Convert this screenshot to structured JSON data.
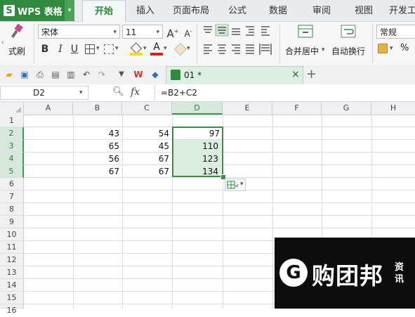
{
  "app": {
    "logo": "S",
    "name": "WPS 表格",
    "dropdown_glyph": "▾"
  },
  "tabs": [
    {
      "label": "开始",
      "active": true
    },
    {
      "label": "插入"
    },
    {
      "label": "页面布局"
    },
    {
      "label": "公式"
    },
    {
      "label": "数据"
    },
    {
      "label": "审阅"
    },
    {
      "label": "视图"
    },
    {
      "label": "开发工"
    }
  ],
  "ribbon": {
    "format_painter_label": "式刷",
    "font_name": "宋体",
    "font_size": "11",
    "grow_font": "A",
    "shrink_font": "A",
    "bold": "B",
    "italic": "I",
    "underline": "U",
    "font_color_letter": "A",
    "merge_label": "合并居中",
    "wrap_label": "自动换行",
    "number_format": "常规",
    "percent": "%"
  },
  "quickbar": {
    "doc_tab_label": "01 *",
    "close_glyph": "×",
    "new_tab_glyph": "+"
  },
  "formula_bar": {
    "name_box": "D2",
    "fx": "fx",
    "formula": "=B2+C2"
  },
  "grid": {
    "columns": [
      "A",
      "B",
      "C",
      "D",
      "E",
      "F",
      "G",
      "H"
    ],
    "active_column": "D",
    "rows": [
      "1",
      "2",
      "3",
      "4",
      "5",
      "6",
      "7",
      "8",
      "9",
      "10",
      "11",
      "12",
      "13",
      "14",
      "15",
      "16"
    ],
    "active_rows": [
      "2",
      "3",
      "4",
      "5"
    ],
    "cells": [
      {
        "ref": "B2",
        "value": "43"
      },
      {
        "ref": "C2",
        "value": "54"
      },
      {
        "ref": "D2",
        "value": "97"
      },
      {
        "ref": "B3",
        "value": "65"
      },
      {
        "ref": "C3",
        "value": "45"
      },
      {
        "ref": "D3",
        "value": "110"
      },
      {
        "ref": "B4",
        "value": "56"
      },
      {
        "ref": "C4",
        "value": "67"
      },
      {
        "ref": "D4",
        "value": "123"
      },
      {
        "ref": "B5",
        "value": "67"
      },
      {
        "ref": "C5",
        "value": "67"
      },
      {
        "ref": "D5",
        "value": "134"
      }
    ]
  },
  "watermark": {
    "icon_letter": "G",
    "text": "购团邦",
    "sub": "资讯"
  },
  "colors": {
    "brand_green": "#2f8a3f",
    "selection_border": "#3a8a48",
    "selection_fill": "#dbeedd"
  }
}
